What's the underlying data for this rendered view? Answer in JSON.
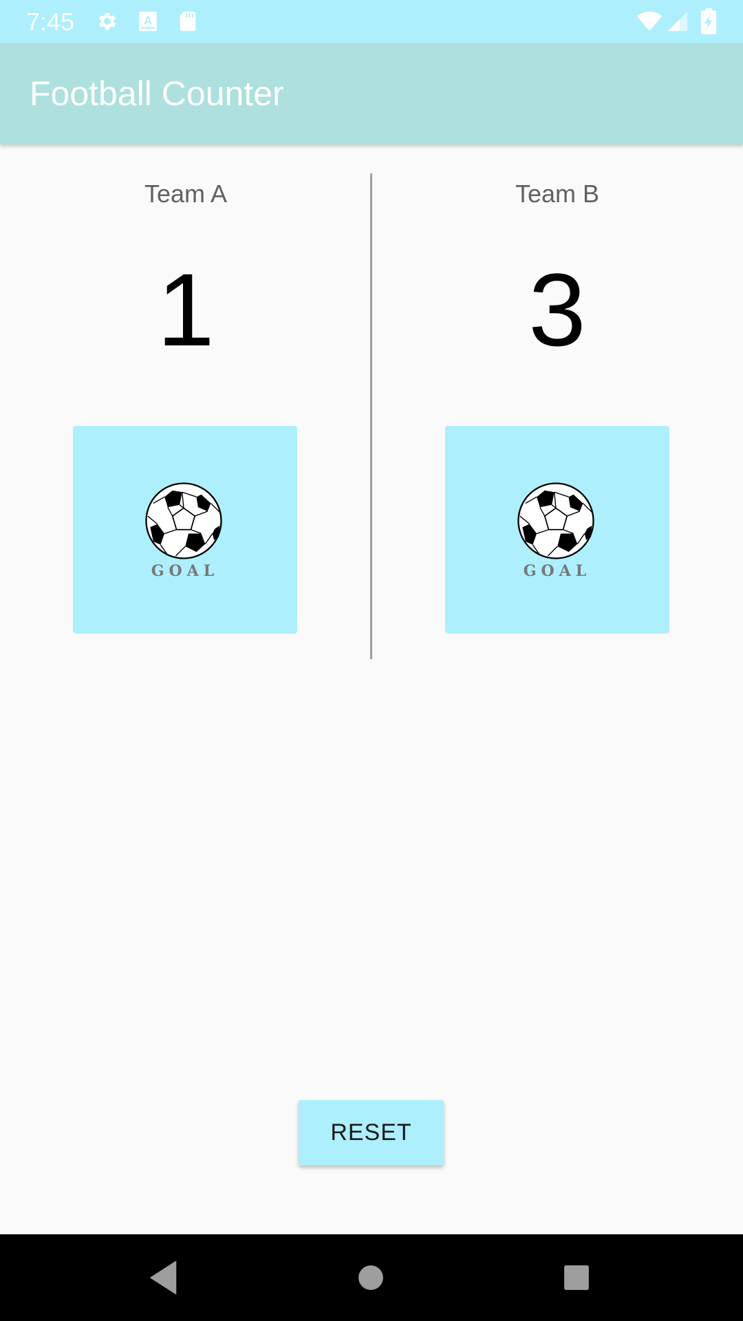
{
  "status_bar": {
    "time": "7:45",
    "icons": [
      "gear-icon",
      "font-icon",
      "sd-card-icon",
      "wifi-icon",
      "signal-icon",
      "battery-charging-icon"
    ]
  },
  "app_bar": {
    "title": "Football Counter"
  },
  "teams": [
    {
      "name": "Team A",
      "score": "1",
      "button_text": "GOAL"
    },
    {
      "name": "Team B",
      "score": "3",
      "button_text": "GOAL"
    }
  ],
  "reset_label": "RESET",
  "nav_bar": {
    "icons": [
      "back-icon",
      "home-icon",
      "recents-icon"
    ]
  },
  "colors": {
    "status_bar": "#aeeffd",
    "app_bar": "#ade0de",
    "button": "#aeeffd",
    "background": "#fafafa"
  }
}
